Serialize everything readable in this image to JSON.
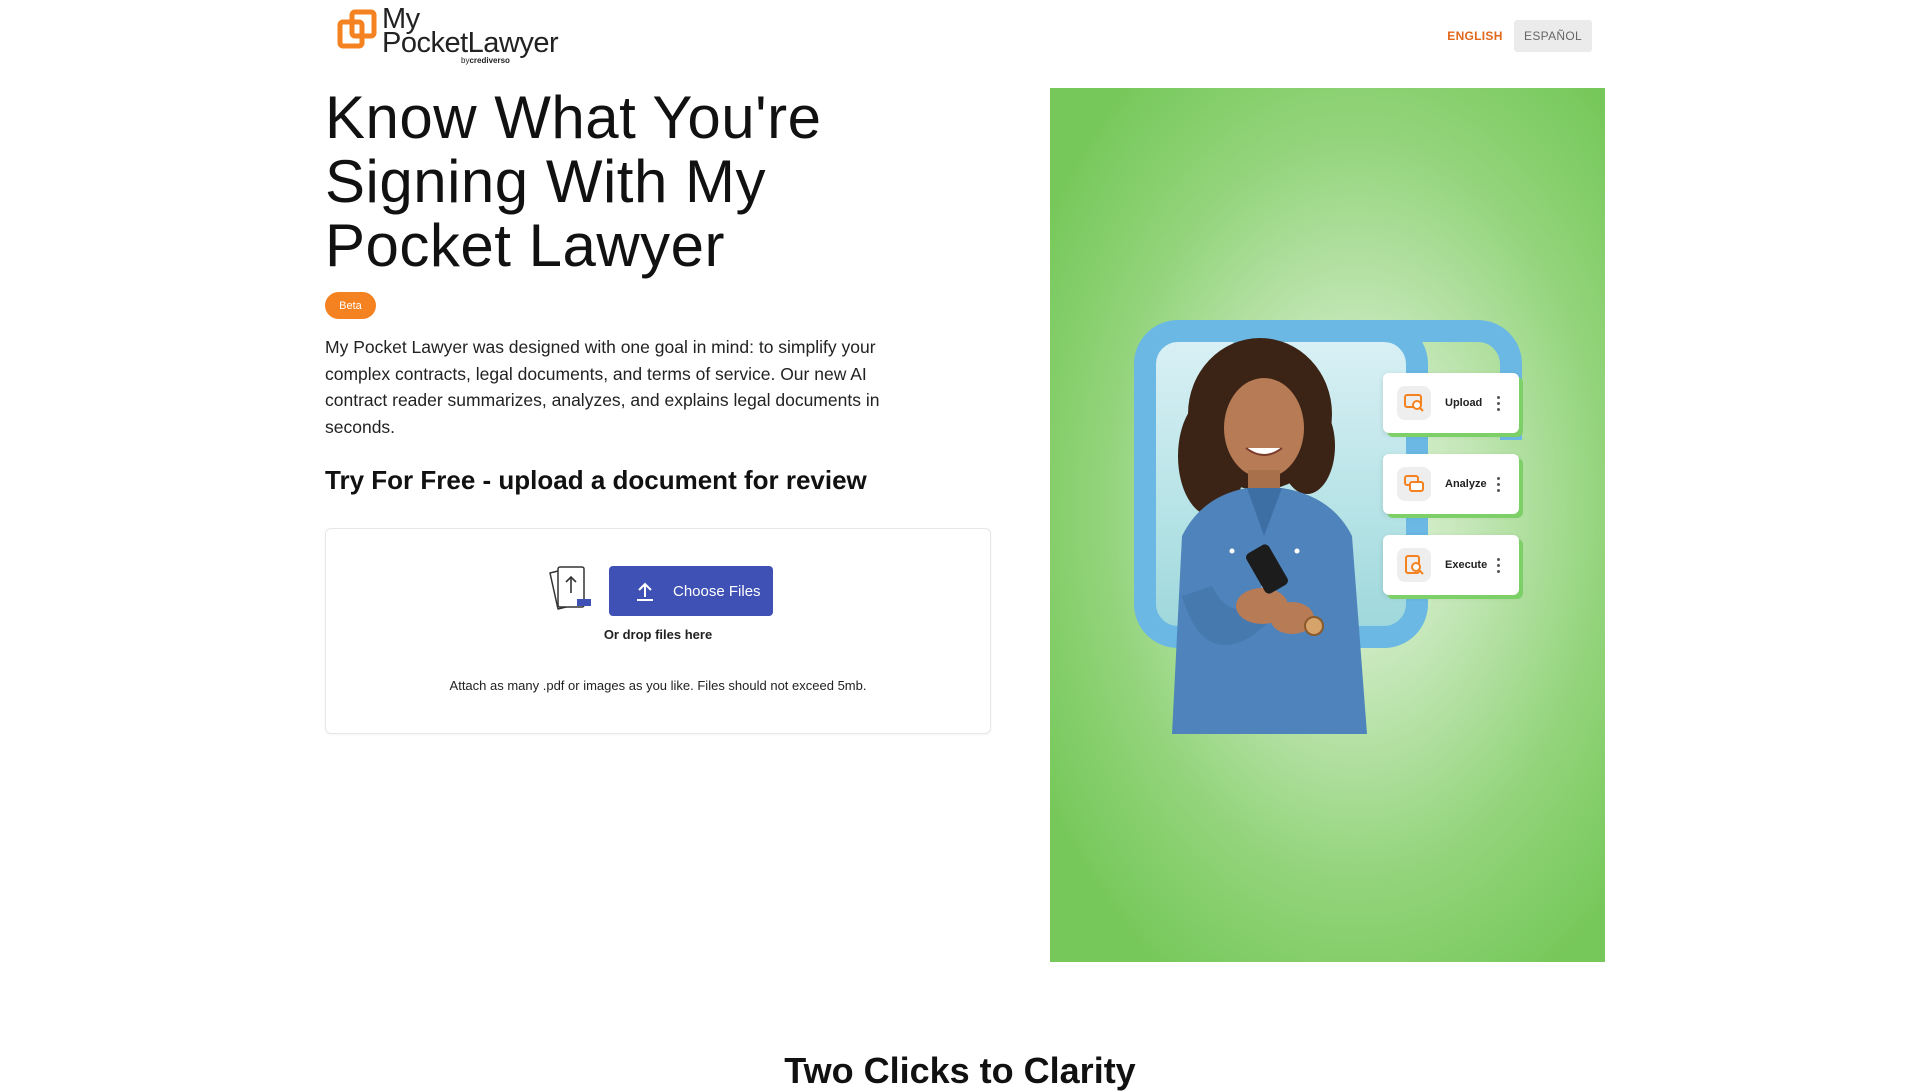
{
  "header": {
    "logo_line1": "My",
    "logo_line2": "PocketLawyer",
    "logo_by": "by",
    "logo_brand": "crediverso",
    "lang_english": "ENGLISH",
    "lang_spanish": "ESPAÑOL"
  },
  "hero": {
    "title": "Know What You're Signing With My Pocket Lawyer",
    "badge": "Beta",
    "description": "My Pocket Lawyer was designed with one goal in mind: to simplify your complex contracts, legal documents, and terms of service. Our new AI contract reader summarizes, analyzes, and explains legal documents in seconds.",
    "try_heading": "Try For Free - upload a document for review"
  },
  "upload": {
    "button_label": "Choose Files",
    "drop_text": "Or drop files here",
    "attach_text": "Attach as many .pdf or images as you like. Files should not exceed 5mb."
  },
  "illustration": {
    "cards": [
      {
        "label": "Upload",
        "icon": "upload-scan-icon"
      },
      {
        "label": "Analyze",
        "icon": "chat-bubbles-icon"
      },
      {
        "label": "Execute",
        "icon": "document-search-icon"
      }
    ]
  },
  "section2": {
    "heading": "Two Clicks to Clarity"
  },
  "colors": {
    "accent_orange": "#f58220",
    "button_blue": "#3f51b5",
    "frame_blue": "#6ab8e3",
    "green": "#76c85a"
  }
}
